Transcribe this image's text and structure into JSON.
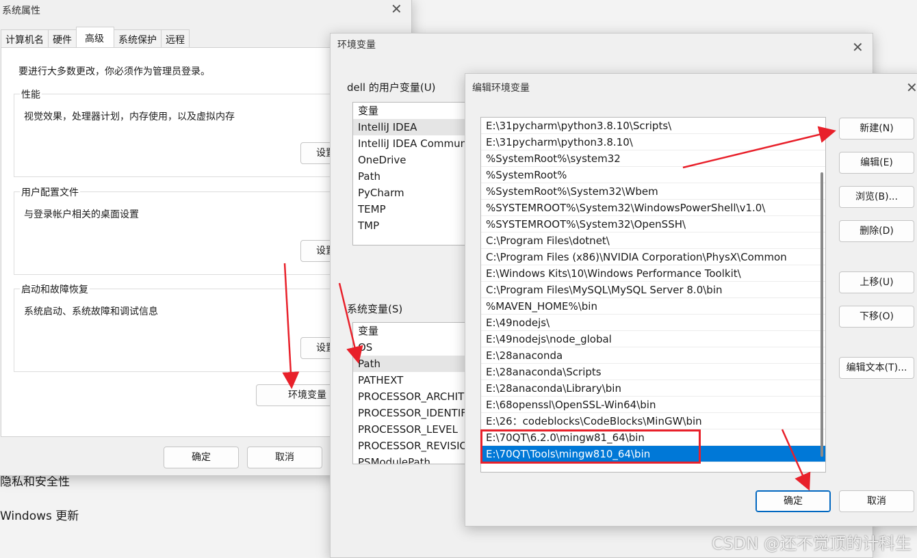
{
  "background": {
    "items": [
      "隐私和安全性",
      "Windows 更新"
    ],
    "buttons": [
      "确定",
      "取消"
    ]
  },
  "system_properties": {
    "title": "系统属性",
    "tabs": [
      "计算机名",
      "硬件",
      "高级",
      "系统保护",
      "远程"
    ],
    "active_tab": "高级",
    "note": "要进行大多数更改，你必须作为管理员登录。",
    "groups": [
      {
        "title": "性能",
        "desc": "视觉效果，处理器计划，内存使用，以及虚拟内存",
        "button": "设置"
      },
      {
        "title": "用户配置文件",
        "desc": "与登录帐户相关的桌面设置",
        "button": "设置"
      },
      {
        "title": "启动和故障恢复",
        "desc": "系统启动、系统故障和调试信息",
        "button": "设置"
      }
    ],
    "env_button": "环境变量",
    "ok": "确定",
    "cancel": "取消"
  },
  "env_vars": {
    "title": "环境变量",
    "user_label": "dell 的用户变量(U)",
    "user_header": "变量",
    "user_rows": [
      "IntelliJ IDEA",
      "IntelliJ IDEA Communi",
      "OneDrive",
      "Path",
      "PyCharm",
      "TEMP",
      "TMP"
    ],
    "system_label": "系统变量(S)",
    "system_header": "变量",
    "system_rows": [
      "OS",
      "Path",
      "PATHEXT",
      "PROCESSOR_ARCHITE",
      "PROCESSOR_IDENTIFI",
      "PROCESSOR_LEVEL",
      "PROCESSOR_REVISION",
      "PSModulePath"
    ]
  },
  "edit_env": {
    "title": "编辑环境变量",
    "paths": [
      "E:\\31pycharm\\python3.8.10\\Scripts\\",
      "E:\\31pycharm\\python3.8.10\\",
      "%SystemRoot%\\system32",
      "%SystemRoot%",
      "%SystemRoot%\\System32\\Wbem",
      "%SYSTEMROOT%\\System32\\WindowsPowerShell\\v1.0\\",
      "%SYSTEMROOT%\\System32\\OpenSSH\\",
      "C:\\Program Files\\dotnet\\",
      "C:\\Program Files (x86)\\NVIDIA Corporation\\PhysX\\Common",
      "E:\\Windows Kits\\10\\Windows Performance Toolkit\\",
      "C:\\Program Files\\MySQL\\MySQL Server 8.0\\bin",
      "%MAVEN_HOME%\\bin",
      "E:\\49nodejs\\",
      "E:\\49nodejs\\node_global",
      "E:\\28anaconda",
      "E:\\28anaconda\\Scripts",
      "E:\\28anaconda\\Library\\bin",
      "E:\\68openssl\\OpenSSL-Win64\\bin",
      "E:\\26：codeblocks\\CodeBlocks\\MinGW\\bin",
      "E:\\70QT\\6.2.0\\mingw81_64\\bin",
      "E:\\70QT\\Tools\\mingw810_64\\bin"
    ],
    "selected_index": 20,
    "buttons": {
      "new": "新建(N)",
      "edit": "编辑(E)",
      "browse": "浏览(B)...",
      "delete": "删除(D)",
      "up": "上移(U)",
      "down": "下移(O)",
      "edit_text": "编辑文本(T)...",
      "ok": "确定",
      "cancel": "取消"
    }
  },
  "watermark": "CSDN @还不觉顶的计科生",
  "colors": {
    "selection": "#0078d7",
    "annotation_red": "#e8202a"
  }
}
